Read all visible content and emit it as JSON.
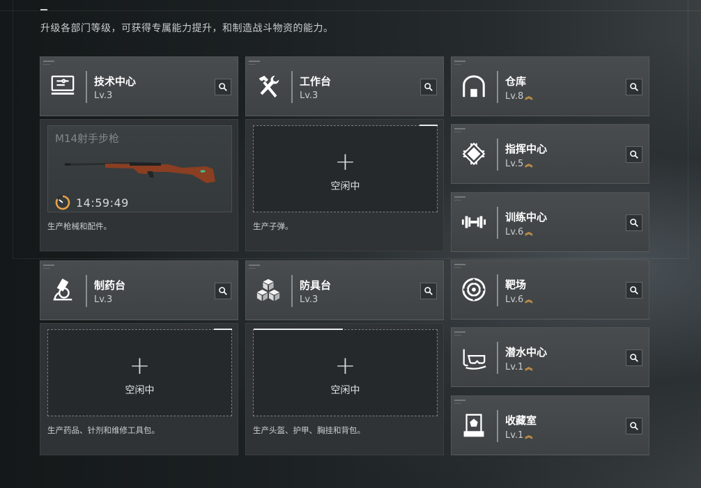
{
  "subtitle": "升级各部门等级，可获得专属能力提升，和制造战斗物资的能力。",
  "production": [
    {
      "name": "技术中心",
      "level": "Lv.3",
      "icon": "monitor-icon",
      "slot": {
        "state": "busy",
        "item": "M14射手步枪",
        "timer": "14:59:49"
      },
      "description": "生产枪械和配件。"
    },
    {
      "name": "工作台",
      "level": "Lv.3",
      "icon": "hammer-wrench-icon",
      "slot": {
        "state": "idle",
        "label": "空闲中"
      },
      "description": "生产子弹。"
    },
    {
      "name": "制药台",
      "level": "Lv.3",
      "icon": "microscope-icon",
      "slot": {
        "state": "idle",
        "label": "空闲中"
      },
      "description": "生产药品、针剂和维修工具包。"
    },
    {
      "name": "防具台",
      "level": "Lv.3",
      "icon": "cubes-icon",
      "slot": {
        "state": "idle",
        "label": "空闲中"
      },
      "description": "生产头盔、护甲、胸挂和背包。"
    }
  ],
  "facilities": [
    {
      "name": "仓库",
      "level": "Lv.8",
      "icon": "warehouse-icon",
      "upgradable": true
    },
    {
      "name": "指挥中心",
      "level": "Lv.5",
      "icon": "chip-icon",
      "upgradable": true
    },
    {
      "name": "训练中心",
      "level": "Lv.6",
      "icon": "dumbbell-icon",
      "upgradable": true
    },
    {
      "name": "靶场",
      "level": "Lv.6",
      "icon": "target-icon",
      "upgradable": true
    },
    {
      "name": "潜水中心",
      "level": "Lv.1",
      "icon": "diving-mask-icon",
      "upgradable": true
    },
    {
      "name": "收藏室",
      "level": "Lv.1",
      "icon": "display-case-icon",
      "upgradable": true
    }
  ],
  "upgrade_chevron": "︽",
  "colors": {
    "accent": "#e7a447",
    "panel": "#3e4244",
    "slot_border": "#7d8284"
  }
}
